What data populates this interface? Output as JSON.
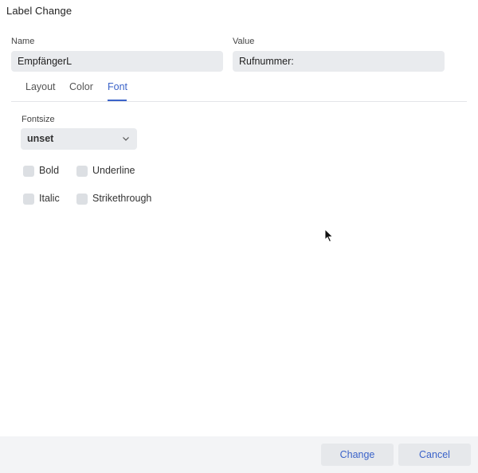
{
  "window": {
    "title": "Label Change"
  },
  "fields": {
    "name": {
      "label": "Name",
      "value": "EmpfängerL"
    },
    "value": {
      "label": "Value",
      "value": "Rufnummer:"
    }
  },
  "tabs": [
    {
      "label": "Layout",
      "active": false
    },
    {
      "label": "Color",
      "active": false
    },
    {
      "label": "Font",
      "active": true
    }
  ],
  "font": {
    "fontsize": {
      "label": "Fontsize",
      "value": "unset"
    },
    "checkboxes": {
      "bold": {
        "label": "Bold",
        "checked": false
      },
      "underline": {
        "label": "Underline",
        "checked": false
      },
      "italic": {
        "label": "Italic",
        "checked": false
      },
      "strikethrough": {
        "label": "Strikethrough",
        "checked": false
      }
    }
  },
  "footer": {
    "change_label": "Change",
    "cancel_label": "Cancel"
  },
  "colors": {
    "accent": "#3b63c9",
    "input_bg": "#e9ebee",
    "footer_bg": "#f3f4f6"
  },
  "icons": {
    "select_arrow": "chevron-down-icon",
    "pointer": "mouse-cursor-icon"
  }
}
